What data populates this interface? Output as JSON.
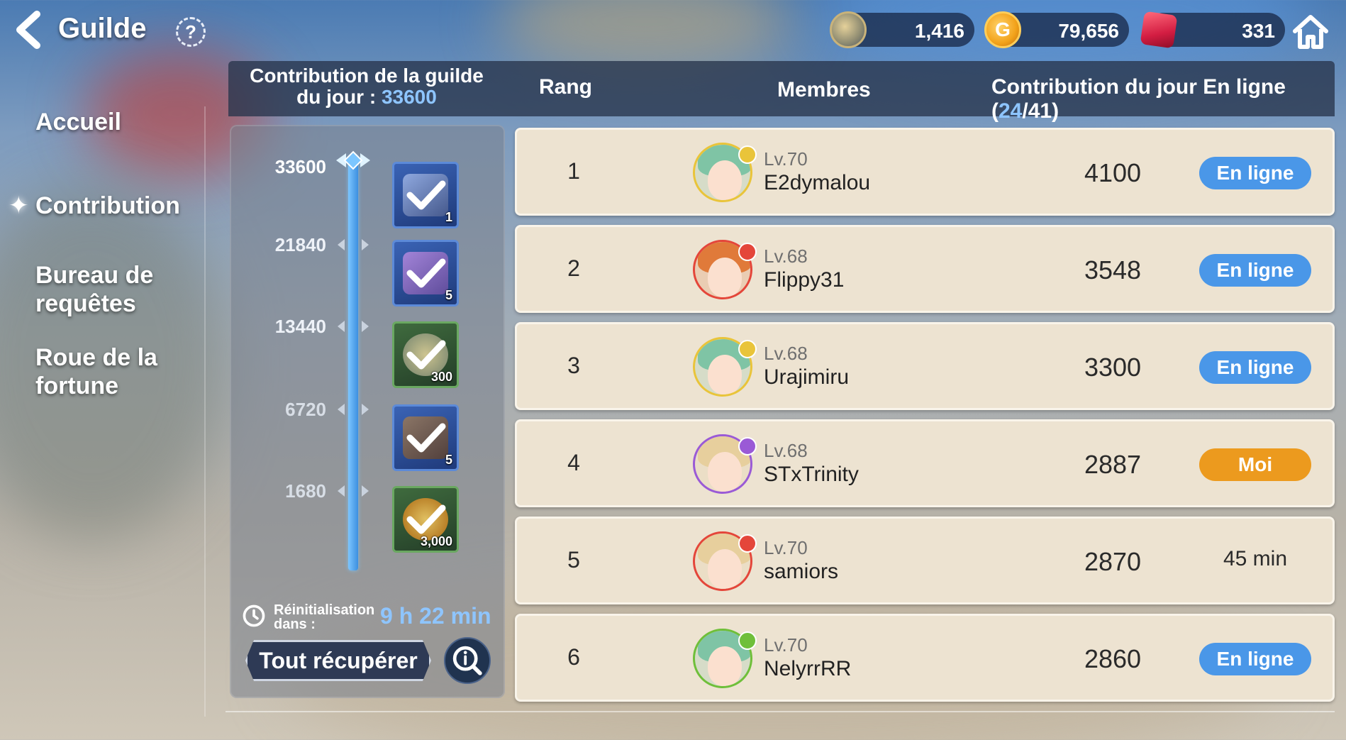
{
  "header": {
    "title": "Guilde",
    "currencies": [
      {
        "name": "guild-coin",
        "value": "1,416"
      },
      {
        "name": "gold",
        "value": "79,656",
        "symbol": "G"
      },
      {
        "name": "gem",
        "value": "331"
      }
    ]
  },
  "nav": {
    "items": [
      {
        "label": "Accueil",
        "active": false
      },
      {
        "label": "Contribution",
        "active": true
      },
      {
        "label": "Bureau de requêtes",
        "active": false
      },
      {
        "label": "Roue de la fortune",
        "active": false
      }
    ]
  },
  "table_header": {
    "guild_contribution_label": "Contribution de la guilde du jour : ",
    "guild_contribution_value": "33600",
    "rank": "Rang",
    "members": "Membres",
    "daily_contribution": "Contribution du jour",
    "online_label": "En ligne",
    "online_count": "24",
    "total_count": "41"
  },
  "rewards": {
    "milestones": [
      "33600",
      "21840",
      "13440",
      "6720",
      "1680"
    ],
    "items": [
      {
        "qty": "1",
        "claimed": true,
        "frame": "blue"
      },
      {
        "qty": "5",
        "claimed": true,
        "frame": "blue"
      },
      {
        "qty": "300",
        "claimed": true,
        "frame": "green"
      },
      {
        "qty": "5",
        "claimed": true,
        "frame": "blue"
      },
      {
        "qty": "3,000",
        "claimed": true,
        "frame": "green"
      }
    ],
    "reset_label": "Réinitialisation dans :",
    "reset_time": "9 h 22 min",
    "claim_all": "Tout récupérer"
  },
  "members": [
    {
      "rank": "1",
      "level": "Lv.70",
      "name": "E2dymalou",
      "contribution": "4100",
      "status": "En ligne",
      "status_type": "online",
      "hair": "#7fc4a5",
      "badge": "#e9c43a"
    },
    {
      "rank": "2",
      "level": "Lv.68",
      "name": "Flippy31",
      "contribution": "3548",
      "status": "En ligne",
      "status_type": "online",
      "hair": "#e07a3a",
      "badge": "#e4463a"
    },
    {
      "rank": "3",
      "level": "Lv.68",
      "name": "Urajimiru",
      "contribution": "3300",
      "status": "En ligne",
      "status_type": "online",
      "hair": "#7fc4a5",
      "badge": "#e9c43a"
    },
    {
      "rank": "4",
      "level": "Lv.68",
      "name": "STxTrinity",
      "contribution": "2887",
      "status": "Moi",
      "status_type": "me",
      "hair": "#e7cf9d",
      "badge": "#9a5ad6"
    },
    {
      "rank": "5",
      "level": "Lv.70",
      "name": "samiors",
      "contribution": "2870",
      "status": "45 min",
      "status_type": "offline",
      "hair": "#e7cf9d",
      "badge": "#e4463a"
    },
    {
      "rank": "6",
      "level": "Lv.70",
      "name": "NelyrrRR",
      "contribution": "2860",
      "status": "En ligne",
      "status_type": "online",
      "hair": "#7fc4a5",
      "badge": "#6fbf3a"
    }
  ],
  "colors": {
    "accent_blue": "#8ec5ff",
    "online_pill": "#4a97e8",
    "me_pill": "#ec9a1e",
    "row_bg": "#ede3d1"
  }
}
